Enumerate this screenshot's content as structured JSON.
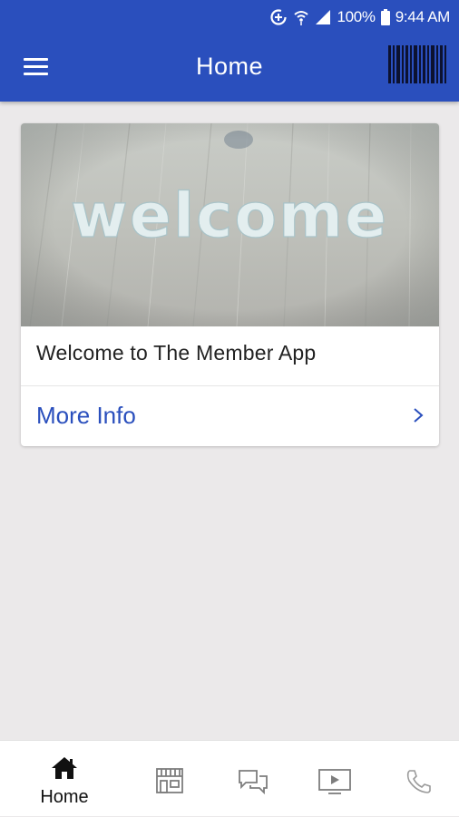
{
  "status_bar": {
    "battery": "100%",
    "time": "9:44 AM"
  },
  "header": {
    "title": "Home",
    "menu_icon": "hamburger-menu-icon",
    "barcode_icon": "barcode-icon"
  },
  "card": {
    "image_word": "welcome",
    "title": "Welcome to The Member App",
    "link_label": "More Info"
  },
  "bottom_nav": {
    "items": [
      {
        "label": "Home",
        "icon": "home-icon",
        "active": true
      },
      {
        "label": "",
        "icon": "store-icon",
        "active": false
      },
      {
        "label": "",
        "icon": "chat-icon",
        "active": false
      },
      {
        "label": "",
        "icon": "video-icon",
        "active": false
      },
      {
        "label": "",
        "icon": "phone-icon",
        "active": false
      }
    ]
  },
  "colors": {
    "primary": "#2a4fbd",
    "background": "#ebe9ea",
    "link": "#2a4fbd"
  }
}
